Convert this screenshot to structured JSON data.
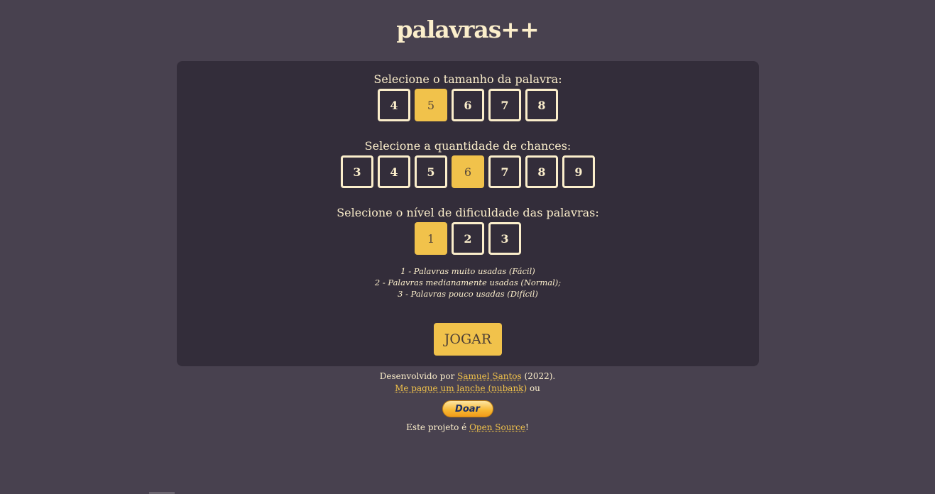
{
  "app": {
    "title": "palavras++"
  },
  "sections": {
    "length": {
      "label": "Selecione o tamanho da palavra:",
      "options": [
        "4",
        "5",
        "6",
        "7",
        "8"
      ],
      "selected": "5"
    },
    "chances": {
      "label": "Selecione a quantidade de chances:",
      "options": [
        "3",
        "4",
        "5",
        "6",
        "7",
        "8",
        "9"
      ],
      "selected": "6"
    },
    "difficulty": {
      "label": "Selecione o nível de dificuldade das palavras:",
      "options": [
        "1",
        "2",
        "3"
      ],
      "selected": "1"
    }
  },
  "legend": [
    "1 - Palavras muito usadas (Fácil)",
    "2 - Palavras medianamente usadas (Normal);",
    "3 - Palavras pouco usadas (Difícil)"
  ],
  "play_label": "JOGAR",
  "footer": {
    "developed_prefix": "Desenvolvido por",
    "author_link": "Samuel Santos",
    "year": "(2022).",
    "snack_link": "Me pague um lanche (nubank)",
    "or_text": "ou",
    "donate_label": "Doar",
    "open_source_prefix": "Este projeto é",
    "open_source_link": "Open Source",
    "open_source_suffix": "!"
  },
  "colors": {
    "background": "#48414f",
    "card": "#332d3a",
    "accent": "#f1c24b",
    "text": "#fbeecb"
  }
}
